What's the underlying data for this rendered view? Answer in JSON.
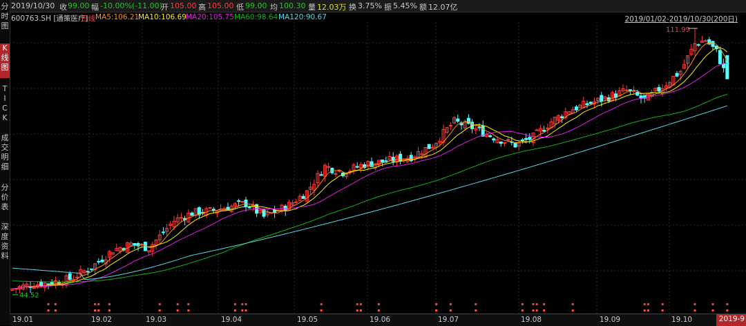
{
  "quote": {
    "date": "2019/10/30",
    "close_label": "收",
    "close": "99.00",
    "change_label": "幅",
    "change": "-10.00%(-11.00)",
    "open_label": "开",
    "open": "105.00",
    "high_label": "高",
    "high": "105.00",
    "low_label": "低",
    "low": "99.00",
    "avg_label": "均",
    "avg": "100.30",
    "volume_label": "量",
    "volume": "12.03万",
    "turnover_label": "换",
    "turnover": "3.75%",
    "amplitude_label": "振",
    "amplitude": "5.45%",
    "amount_label": "额",
    "amount": "12.07亿"
  },
  "ma_bar": {
    "symbol": "600763.SH [通策医疗]",
    "period": "日线",
    "ma5": "MA5:106.21",
    "ma10": "MA10:106.69",
    "ma20": "MA20:105.75",
    "ma60": "MA60:98.64",
    "ma120": "MA120:90.67",
    "range": "2019/01/02-2019/10/30(200日)"
  },
  "colors": {
    "up": "#ff3b3b",
    "down": "#54ffff",
    "ma5": "#ff8c1a",
    "ma10": "#ffee00",
    "ma20": "#e020e0",
    "ma60": "#16b016",
    "ma120": "#5ad7e6",
    "green_text": "#1ec81e",
    "accent": "#b3262a"
  },
  "sidebar": [
    {
      "label": "分\n时\n图",
      "icon": "timeshare"
    },
    {
      "label": "K\n线\n图",
      "icon": "kline",
      "active": true
    },
    {
      "label": "T\nI\nC\nK",
      "icon": "tick"
    },
    {
      "label": "成\n交\n明\n细",
      "icon": "trades"
    },
    {
      "label": "分\n价\n表",
      "icon": "price-table"
    },
    {
      "label": "深\n度\n资\n料",
      "icon": "f10"
    }
  ],
  "xaxis": {
    "labels": [
      "19.01",
      "19.02",
      "19.03",
      "19.04",
      "19.05",
      "19.06",
      "19.07",
      "19.08",
      "19.09",
      "19.10"
    ],
    "cursor_date": "2019-9"
  },
  "annotations": {
    "high_mark": "111.99",
    "low_mark": "44.52"
  },
  "chart_data": {
    "type": "candlestick",
    "ylim": [
      40,
      120
    ],
    "x": "trading days 2019/01/02-2019/10/30",
    "points": 200,
    "high": 111.99,
    "low": 44.52,
    "last_close": 99.0,
    "close_waypoints": [
      [
        0,
        45
      ],
      [
        5,
        46
      ],
      [
        10,
        46.5
      ],
      [
        16,
        47.5
      ],
      [
        22,
        50.5
      ],
      [
        28,
        55
      ],
      [
        33,
        56.5
      ],
      [
        38,
        55.5
      ],
      [
        45,
        62.5
      ],
      [
        50,
        64.5
      ],
      [
        55,
        65
      ],
      [
        60,
        66
      ],
      [
        65,
        67
      ],
      [
        70,
        63.5
      ],
      [
        77,
        66.5
      ],
      [
        82,
        70
      ],
      [
        87,
        76.5
      ],
      [
        92,
        75
      ],
      [
        98,
        77
      ],
      [
        105,
        78
      ],
      [
        111,
        79
      ],
      [
        117,
        82
      ],
      [
        123,
        88
      ],
      [
        128,
        86.5
      ],
      [
        134,
        84
      ],
      [
        140,
        82
      ],
      [
        145,
        84
      ],
      [
        150,
        88
      ],
      [
        155,
        91
      ],
      [
        160,
        92.5
      ],
      [
        165,
        94
      ],
      [
        171,
        96
      ],
      [
        176,
        93.5
      ],
      [
        181,
        97
      ],
      [
        186,
        101
      ],
      [
        190,
        108
      ],
      [
        193,
        109
      ],
      [
        196,
        106
      ],
      [
        199,
        99
      ]
    ],
    "ma_series": [
      {
        "name": "MA5",
        "color": "#ff8c1a"
      },
      {
        "name": "MA10",
        "color": "#ffee00"
      },
      {
        "name": "MA20",
        "color": "#e020e0"
      },
      {
        "name": "MA60",
        "color": "#16b016"
      },
      {
        "name": "MA120",
        "color": "#5ad7e6"
      }
    ],
    "ma_end_values": {
      "MA5": 106.21,
      "MA10": 106.69,
      "MA20": 105.75,
      "MA60": 98.64,
      "MA120": 90.67
    },
    "ma120_start": 50.3,
    "event_marker_days": [
      10,
      12,
      23,
      24,
      27,
      41,
      46,
      49,
      62,
      64,
      65,
      86,
      96,
      97,
      102,
      118,
      122,
      129,
      142,
      145,
      146,
      148,
      156,
      176,
      177,
      181,
      190,
      195,
      199
    ]
  }
}
